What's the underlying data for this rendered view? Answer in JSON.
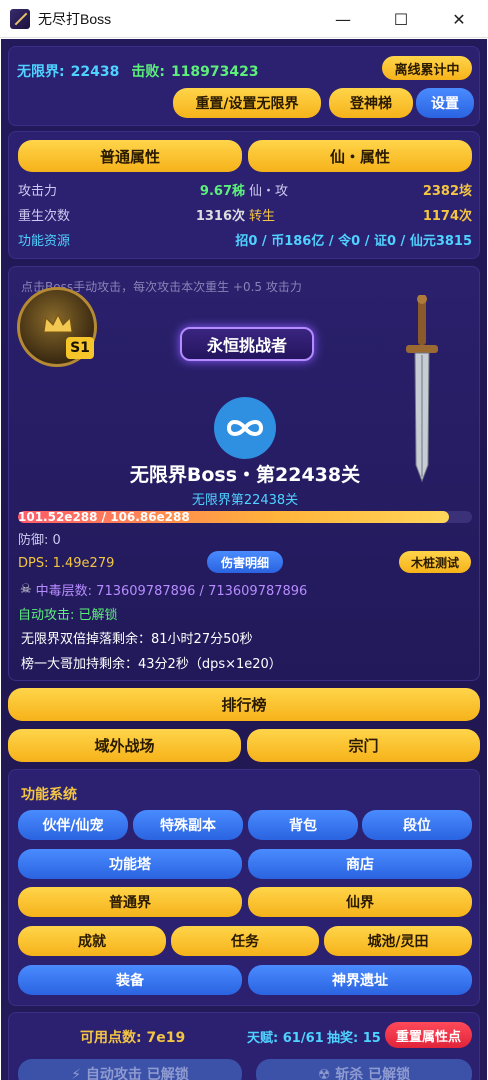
{
  "window": {
    "title": "无尽打Boss",
    "minimize": "—",
    "maximize": "☐",
    "close": "✕"
  },
  "top": {
    "realm_label": "无限界:",
    "realm_value": "22438",
    "defeat_label": "击败:",
    "defeat_value": "118973423",
    "offline": "离线累计中",
    "reset_button": "重置/设置无限界",
    "ladder_button": "登神梯",
    "settings_button": "设置"
  },
  "attrs": {
    "tab_normal": "普通属性",
    "tab_immortal": "仙・属性",
    "rows": [
      {
        "left_label": "攻击力",
        "left_value": "9.67秭",
        "right_label": "仙・攻",
        "right_value": "2382垓"
      },
      {
        "left_label": "重生次数",
        "left_value": "1316次",
        "right_label": "转生",
        "right_value": "1174次"
      }
    ],
    "resources_label": "功能资源",
    "resources_value": "招0 / 币186亿 / 令0 / 证0 / 仙元3815"
  },
  "boss": {
    "hint": "点击Boss手动攻击，每次攻击本次重生 +0.5 攻击力",
    "season_badge": "S1",
    "title_banner": "永恒挑战者",
    "name": "无限界Boss・第22438关",
    "subtitle": "无限界第22438关",
    "hp_text": "101.52e288 / 106.86e288",
    "hp_fraction": 0.95,
    "defense": "防御: 0",
    "dps": "DPS: 1.49e279",
    "damage_detail_button": "伤害明细",
    "dummy_test_button": "木桩测试",
    "poison": "中毒层数: 713609787896 / 713609787896",
    "auto_attack": "自动攻击: 已解锁",
    "double_drop": "无限界双倍掉落剩余：81小时27分50秒",
    "big_brother": "榜一大哥加持剩余：43分2秒（dps×1e20）"
  },
  "nav": {
    "leaderboard": "排行榜",
    "outer_battlefield": "域外战场",
    "sect": "宗门"
  },
  "features": {
    "title": "功能系统",
    "buttons": {
      "partner": "伙伴/仙宠",
      "special_dungeon": "特殊副本",
      "backpack": "背包",
      "rank": "段位",
      "tower": "功能塔",
      "shop": "商店",
      "normal_realm": "普通界",
      "immortal_realm": "仙界",
      "achievement": "成就",
      "task": "任务",
      "city": "城池/灵田",
      "equipment": "装备",
      "divine_ruins": "神界遗址"
    }
  },
  "bottom": {
    "points": "可用点数: 7e19",
    "talent": "天赋: 61/61",
    "lottery": "抽奖: 15",
    "reset_points": "重置属性点",
    "auto_attack_unlocked": "⚡ 自动攻击 已解锁",
    "slay_unlocked": "☢ 斩杀 已解锁"
  },
  "colors": {
    "bg": "#231a5c",
    "panel": "#2b2170",
    "gold": "#f6b21a",
    "blue": "#2a63e0",
    "cyan": "#4fd2ff",
    "green": "#5cf07a",
    "red": "#e0243a"
  }
}
